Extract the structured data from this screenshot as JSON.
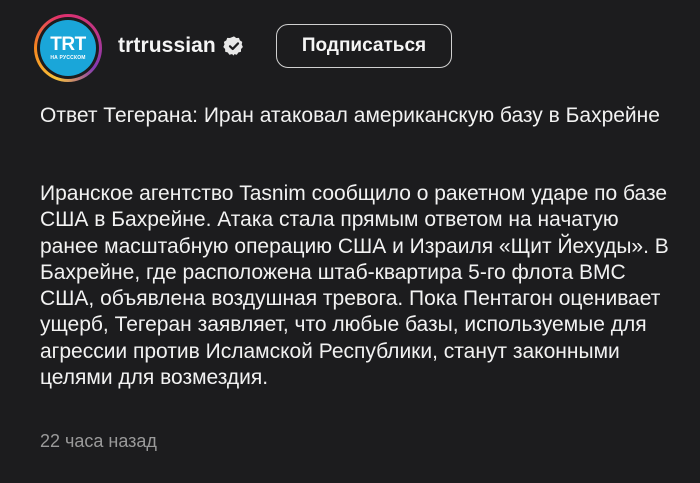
{
  "profile": {
    "avatar_logo": "TRT",
    "avatar_sub": "НА РУССКОМ",
    "username": "trtrussian",
    "verified_icon": "verified-badge-icon"
  },
  "subscribe_button": {
    "label": "Подписаться"
  },
  "post": {
    "title": "Ответ Тегерана: Иран атаковал американскую базу в Бахрейне",
    "body": "Иранское агентство Tasnim сообщило о ракетном ударе по базе США в Бахрейне. Атака стала прямым ответом на начатую ранее масштабную операцию США и Израиля «Щит Йехуды». В Бахрейне, где расположена штаб-квартира 5-го флота ВМС США, объявлена воздушная тревога. Пока Пентагон оценивает ущерб, Тегеран заявляет, что любые базы, используемые для агрессии против Исламской Республики, станут законными целями для возмездия.",
    "timestamp": "22 часа назад"
  },
  "colors": {
    "background": "#1c1c1e",
    "text": "#f2f2f2",
    "muted_text": "#9a9a9a",
    "avatar_bg": "#1aa6d9"
  }
}
